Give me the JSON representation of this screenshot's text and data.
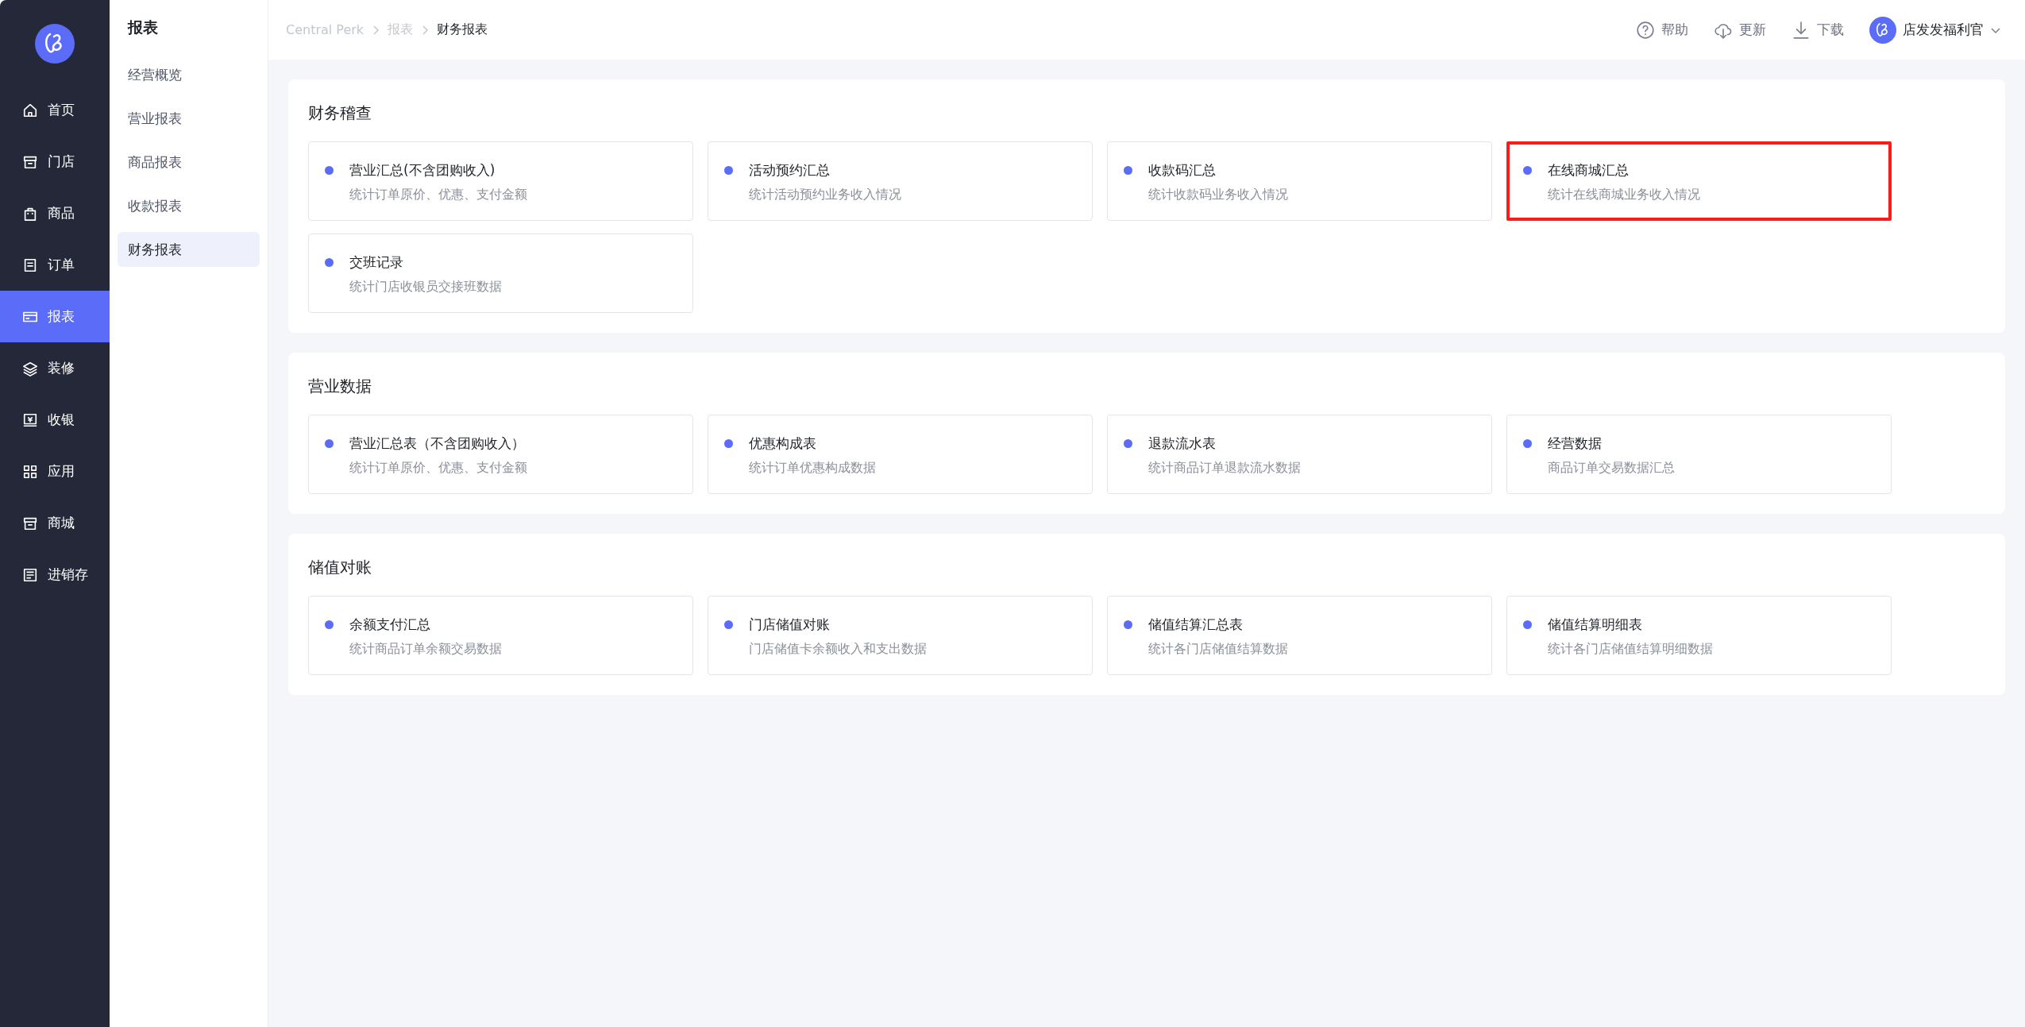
{
  "nav": {
    "items": [
      {
        "label": "首页",
        "selected": false
      },
      {
        "label": "门店",
        "selected": false
      },
      {
        "label": "商品",
        "selected": false
      },
      {
        "label": "订单",
        "selected": false
      },
      {
        "label": "报表",
        "selected": true
      },
      {
        "label": "装修",
        "selected": false
      },
      {
        "label": "收银",
        "selected": false
      },
      {
        "label": "应用",
        "selected": false
      },
      {
        "label": "商城",
        "selected": false
      },
      {
        "label": "进销存",
        "selected": false
      }
    ]
  },
  "submenu": {
    "title": "报表",
    "items": [
      {
        "label": "经营概览",
        "selected": false
      },
      {
        "label": "营业报表",
        "selected": false
      },
      {
        "label": "商品报表",
        "selected": false
      },
      {
        "label": "收款报表",
        "selected": false
      },
      {
        "label": "财务报表",
        "selected": true
      }
    ]
  },
  "breadcrumb": [
    {
      "label": "Central Perk",
      "current": false
    },
    {
      "label": "报表",
      "current": false
    },
    {
      "label": "财务报表",
      "current": true
    }
  ],
  "header_actions": [
    {
      "label": "帮助"
    },
    {
      "label": "更新"
    },
    {
      "label": "下载"
    }
  ],
  "user": {
    "name": "店发发福利官"
  },
  "sections": [
    {
      "title": "财务稽查",
      "cards": [
        {
          "title": "营业汇总(不含团购收入)",
          "description": "统计订单原价、优惠、支付金额",
          "highlighted": false
        },
        {
          "title": "活动预约汇总",
          "description": "统计活动预约业务收入情况",
          "highlighted": false
        },
        {
          "title": "收款码汇总",
          "description": "统计收款码业务收入情况",
          "highlighted": false
        },
        {
          "title": "在线商城汇总",
          "description": "统计在线商城业务收入情况",
          "highlighted": true
        },
        {
          "title": "交班记录",
          "description": "统计门店收银员交接班数据",
          "highlighted": false
        }
      ]
    },
    {
      "title": "营业数据",
      "cards": [
        {
          "title": "营业汇总表（不含团购收入）",
          "description": "统计订单原价、优惠、支付金额",
          "highlighted": false
        },
        {
          "title": "优惠构成表",
          "description": "统计订单优惠构成数据",
          "highlighted": false
        },
        {
          "title": "退款流水表",
          "description": "统计商品订单退款流水数据",
          "highlighted": false
        },
        {
          "title": "经营数据",
          "description": "商品订单交易数据汇总",
          "highlighted": false
        }
      ]
    },
    {
      "title": "储值对账",
      "cards": [
        {
          "title": "余额支付汇总",
          "description": "统计商品订单余额交易数据",
          "highlighted": false
        },
        {
          "title": "门店储值对账",
          "description": "门店储值卡余额收入和支出数据",
          "highlighted": false
        },
        {
          "title": "储值结算汇总表",
          "description": "统计各门店储值结算数据",
          "highlighted": false
        },
        {
          "title": "储值结算明细表",
          "description": "统计各门店储值结算明细数据",
          "highlighted": false
        }
      ]
    }
  ]
}
